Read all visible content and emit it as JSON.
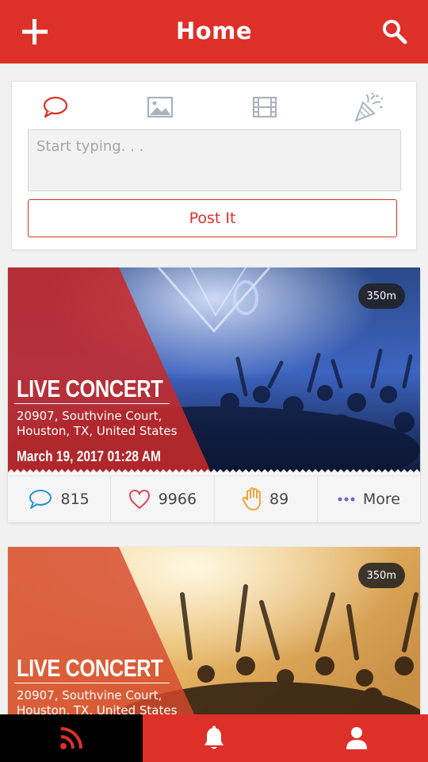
{
  "header": {
    "title": "Home",
    "add_icon": "plus-icon",
    "search_icon": "search-icon"
  },
  "composer": {
    "types": [
      "comment-icon",
      "image-icon",
      "film-icon",
      "party-popper-icon"
    ],
    "placeholder": "Start typing. . .",
    "post_label": "Post It"
  },
  "posts": [
    {
      "distance": "350m",
      "title": "LIVE CONCERT",
      "address": "20907, Southvine Court, Houston, TX, United States",
      "datetime": "March 19, 2017 01:28 AM",
      "comments": "815",
      "likes": "9966",
      "hands": "89",
      "more_label": "More"
    },
    {
      "distance": "350m",
      "title": "LIVE CONCERT",
      "address": "20907, Southvine Court, Houston, TX, United States"
    }
  ],
  "bottom_nav": [
    "rss-icon",
    "bell-icon",
    "user-icon"
  ],
  "colors": {
    "brand_red": "#dd3028",
    "active_tab": "#000000"
  }
}
